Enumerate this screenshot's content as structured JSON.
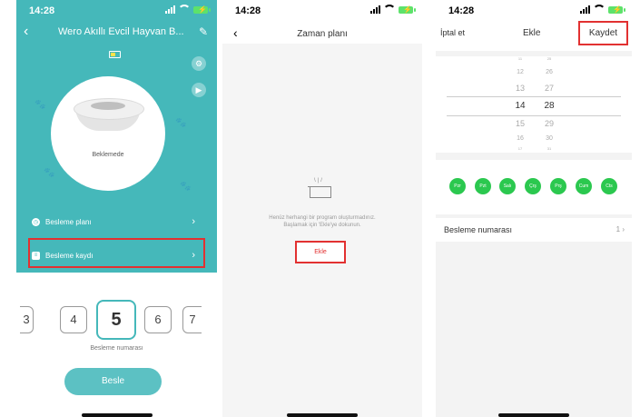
{
  "status": {
    "time": "14:28"
  },
  "device": {
    "title": "Wero Akıllı Evcil Hayvan B...",
    "state": "Beklemede",
    "menu": [
      {
        "label": "Besleme planı"
      },
      {
        "label": "Besleme kaydı"
      }
    ],
    "portions": {
      "values": [
        "3",
        "4",
        "5",
        "6",
        "7"
      ],
      "selected": "5",
      "caption": "Besleme numarası"
    },
    "feed_button": "Besle"
  },
  "schedule": {
    "title": "Zaman planı",
    "empty_message_line1": "Henüz herhangi bir program oluşturmadınız.",
    "empty_message_line2": "Başlamak için 'Ekle'ye dokunun.",
    "add_button": "Ekle"
  },
  "add_schedule": {
    "cancel": "İptal et",
    "title": "Ekle",
    "save": "Kaydet",
    "hours": [
      "11",
      "12",
      "13",
      "14",
      "15",
      "16",
      "17"
    ],
    "minutes": [
      "25",
      "26",
      "27",
      "28",
      "29",
      "30",
      "31"
    ],
    "selected_hour": "14",
    "selected_minute": "28",
    "days": [
      "Pzr",
      "Pzt",
      "Salı",
      "Çrş",
      "Prş",
      "Cum",
      "Cts"
    ],
    "count_label": "Besleme numarası",
    "count_value": "1"
  },
  "colors": {
    "teal": "#45b8ba",
    "highlight": "#e23131",
    "day_green": "#2bc84f"
  }
}
